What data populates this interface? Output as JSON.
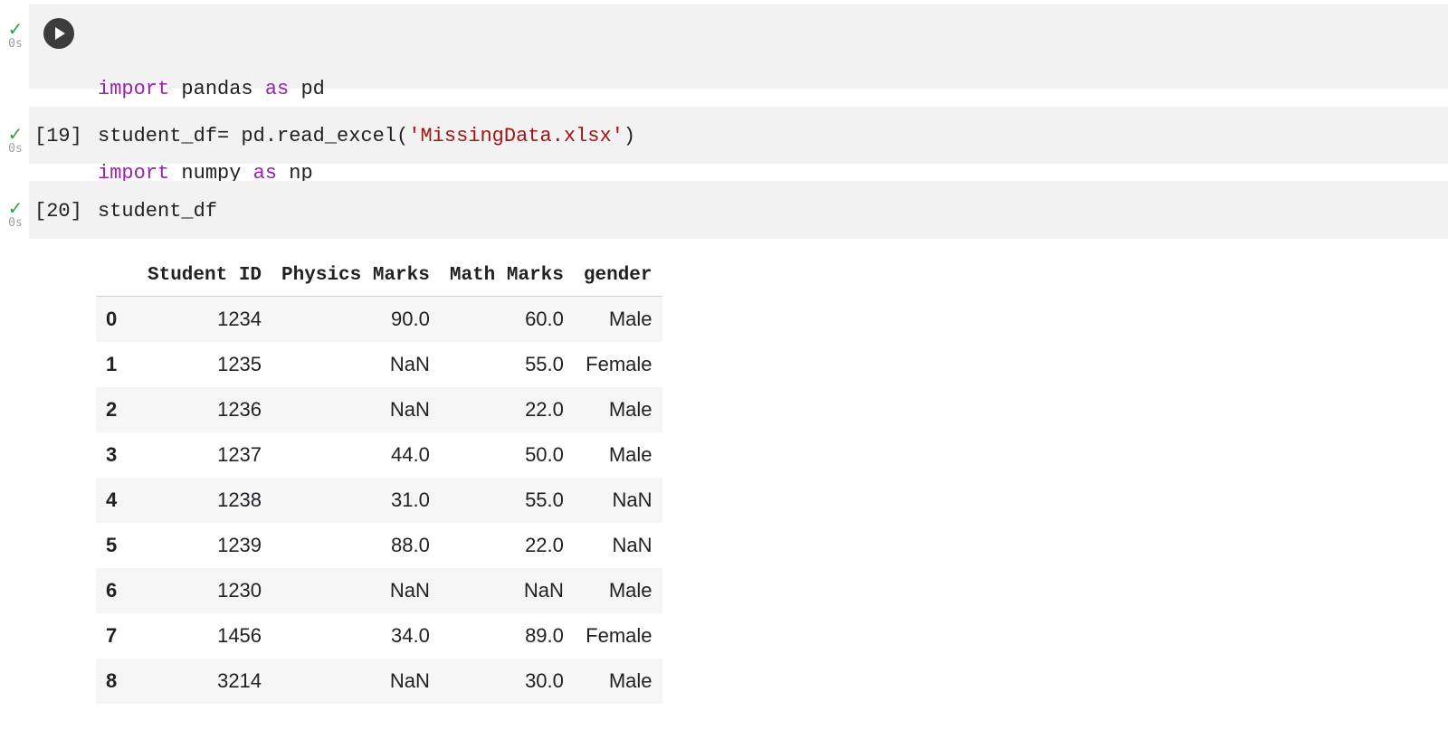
{
  "cells": [
    {
      "status_icon": "check-icon",
      "duration": "0s",
      "code_lines": [
        {
          "kw1": "import",
          "mod": " pandas ",
          "kw2": "as",
          "alias": " pd"
        },
        {
          "kw1": "import",
          "mod": " numpy ",
          "kw2": "as",
          "alias": " np"
        }
      ]
    },
    {
      "status_icon": "check-icon",
      "duration": "0s",
      "exec_count": "[19]",
      "code_pre": "student_df= pd.read_excel(",
      "code_str": "'MissingData.xlsx'",
      "code_post": ")"
    },
    {
      "status_icon": "check-icon",
      "duration": "0s",
      "exec_count": "[20]",
      "code": "student_df"
    }
  ],
  "output_table": {
    "columns": [
      "Student ID",
      "Physics Marks",
      "Math Marks",
      "gender"
    ],
    "rows": [
      {
        "index": "0",
        "values": [
          "1234",
          "90.0",
          "60.0",
          "Male"
        ]
      },
      {
        "index": "1",
        "values": [
          "1235",
          "NaN",
          "55.0",
          "Female"
        ]
      },
      {
        "index": "2",
        "values": [
          "1236",
          "NaN",
          "22.0",
          "Male"
        ]
      },
      {
        "index": "3",
        "values": [
          "1237",
          "44.0",
          "50.0",
          "Male"
        ]
      },
      {
        "index": "4",
        "values": [
          "1238",
          "31.0",
          "55.0",
          "NaN"
        ]
      },
      {
        "index": "5",
        "values": [
          "1239",
          "88.0",
          "22.0",
          "NaN"
        ]
      },
      {
        "index": "6",
        "values": [
          "1230",
          "NaN",
          "NaN",
          "Male"
        ]
      },
      {
        "index": "7",
        "values": [
          "1456",
          "34.0",
          "89.0",
          "Female"
        ]
      },
      {
        "index": "8",
        "values": [
          "3214",
          "NaN",
          "30.0",
          "Male"
        ]
      }
    ]
  },
  "colors": {
    "check": "#2e9e4f",
    "keyword": "#9b1fb0",
    "string": "#a31515",
    "cell_bg": "#f2f2f2"
  }
}
